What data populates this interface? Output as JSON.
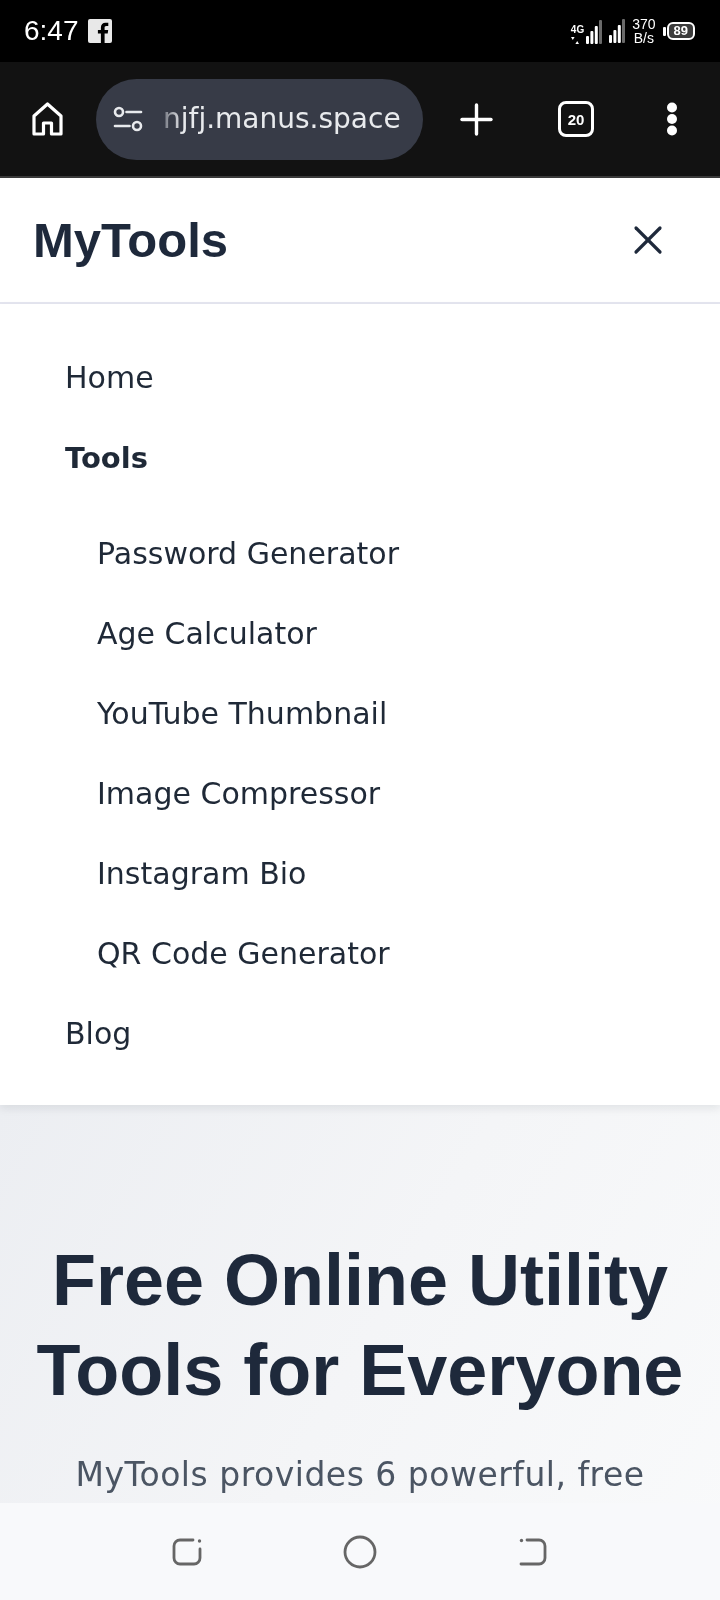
{
  "status_bar": {
    "time": "6:47",
    "network_type": "4G",
    "speed": "370 B/s",
    "battery": "89"
  },
  "browser": {
    "url": "njfj.manus.space",
    "tab_count": "20"
  },
  "header": {
    "title": "MyTools"
  },
  "nav_menu": {
    "items": [
      {
        "label": "Home",
        "kind": "link"
      },
      {
        "label": "Tools",
        "kind": "group",
        "children": [
          {
            "label": "Password Generator",
            "kind": "link"
          },
          {
            "label": "Age Calculator",
            "kind": "link"
          },
          {
            "label": "YouTube Thumbnail",
            "kind": "link"
          },
          {
            "label": "Image Compressor",
            "kind": "link"
          },
          {
            "label": "Instagram Bio",
            "kind": "link"
          },
          {
            "label": "QR Code Generator",
            "kind": "link"
          }
        ]
      },
      {
        "label": "Blog",
        "kind": "link"
      }
    ]
  },
  "hero": {
    "title": "Free Online Utility Tools for Everyone",
    "description": "MyTools provides 6 powerful, free"
  }
}
